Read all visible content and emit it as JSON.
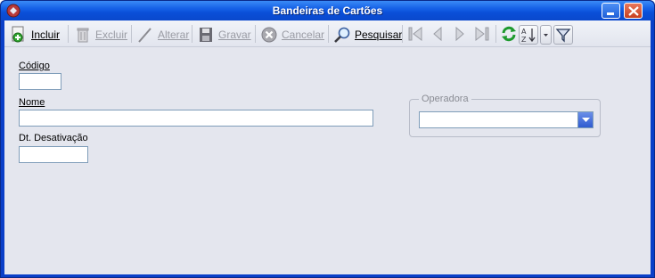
{
  "window": {
    "title": "Bandeiras de Cartões"
  },
  "toolbar": {
    "incluir": "Incluir",
    "excluir": "Excluir",
    "alterar": "Alterar",
    "gravar": "Gravar",
    "cancelar": "Cancelar",
    "pesquisar": "Pesquisar"
  },
  "form": {
    "codigo_label": "Código",
    "codigo_value": "",
    "nome_label": "Nome",
    "nome_value": "",
    "dt_desativacao_label": "Dt. Desativação",
    "dt_desativacao_value": "",
    "operadora_legend": "Operadora",
    "operadora_value": ""
  },
  "colors": {
    "titlebar": "#1560e6",
    "client_bg": "#e4e6ee",
    "input_border": "#7f9db9",
    "disabled_text": "#9a9ca4"
  },
  "icons": [
    "app-icon",
    "minimize-icon",
    "close-icon",
    "add-document-icon",
    "trash-icon",
    "pencil-icon",
    "save-icon",
    "cancel-icon",
    "magnifier-icon",
    "first-record-icon",
    "previous-record-icon",
    "next-record-icon",
    "last-record-icon",
    "refresh-icon",
    "sort-icon",
    "dropdown-arrow-icon",
    "filter-icon"
  ]
}
